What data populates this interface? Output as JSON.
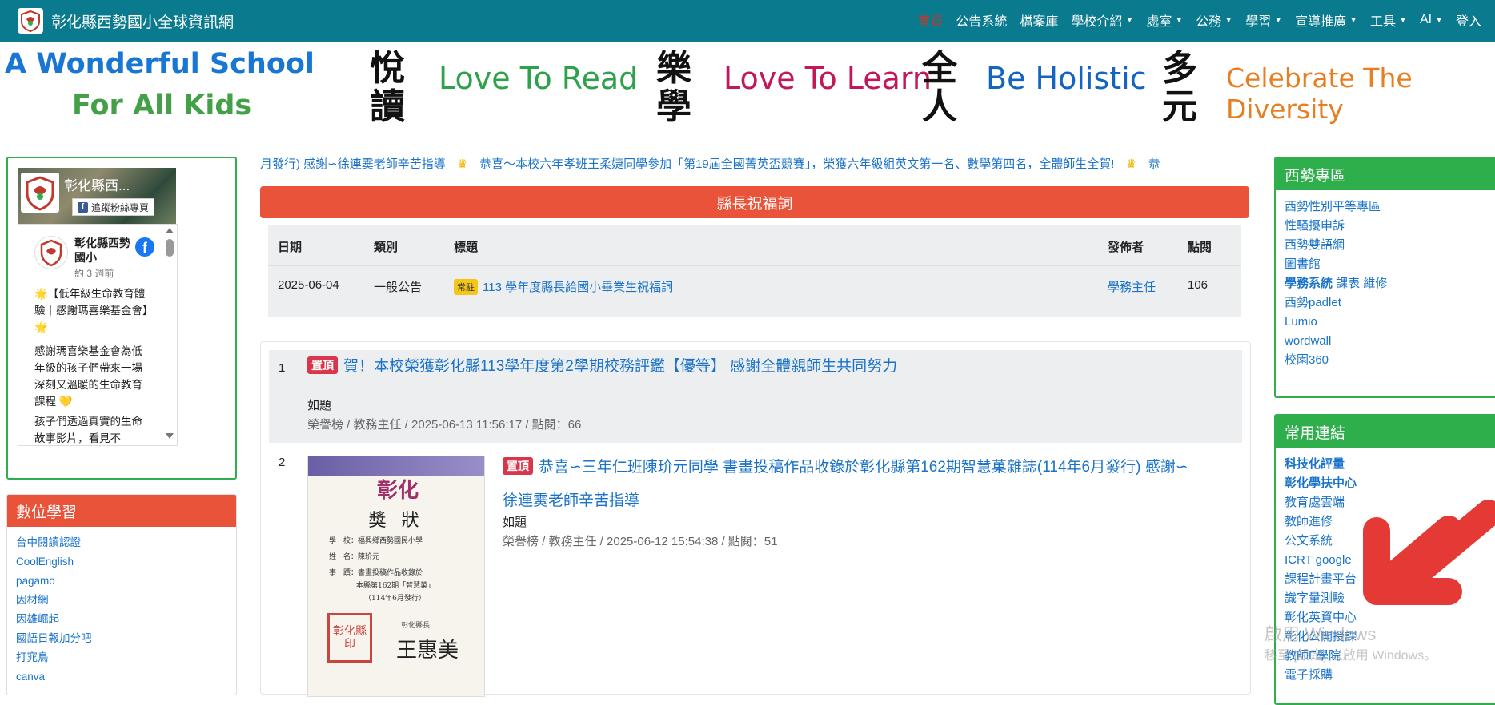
{
  "header": {
    "title": "彰化縣西勢國小全球資訊網",
    "nav": [
      {
        "label": "首頁",
        "active": true,
        "dropdown": false
      },
      {
        "label": "公告系統",
        "dropdown": false
      },
      {
        "label": "檔案庫",
        "dropdown": false
      },
      {
        "label": "學校介紹",
        "dropdown": true
      },
      {
        "label": "處室",
        "dropdown": true
      },
      {
        "label": "公務",
        "dropdown": true
      },
      {
        "label": "學習",
        "dropdown": true
      },
      {
        "label": "宣導推廣",
        "dropdown": true
      },
      {
        "label": "工具",
        "dropdown": true
      },
      {
        "label": "AI",
        "dropdown": true
      },
      {
        "label": "登入",
        "dropdown": false
      }
    ]
  },
  "banner": {
    "line1": "A Wonderful School",
    "line2": "For All Kids",
    "items": [
      {
        "cjk1": "悅",
        "cjk2": "讀",
        "text": "Love To Read",
        "color": "#2da24a"
      },
      {
        "cjk1": "樂",
        "cjk2": "學",
        "text": "Love To Learn",
        "color": "#c2185b"
      },
      {
        "cjk1": "全",
        "cjk2": "人",
        "text": "Be Holistic",
        "color": "#1565c0"
      },
      {
        "cjk1": "多",
        "cjk2": "元",
        "text": "Celebrate The Diversity",
        "color": "#e67e22"
      }
    ]
  },
  "facebook": {
    "page_name": "彰化縣西...",
    "follow_label": "追蹤粉絲專頁",
    "post_name": "彰化縣西勢國小",
    "post_time": "約 3 週前",
    "post_line1": "🌟【低年級生命教育體驗｜感謝瑪喜樂基金會】🌟",
    "post_line2": "感謝瑪喜樂基金會為低年級的孩子們帶來一場深刻又溫暖的生命教育課程 💛",
    "post_line3": "孩子們透過真實的生命故事影片，看見不"
  },
  "digital": {
    "title": "數位學習",
    "links": [
      "台中閱讀認證",
      "CoolEnglish",
      "pagamo",
      "因材網",
      "因雄崛起",
      "國語日報加分吧",
      "打窕鳥",
      "canva"
    ]
  },
  "marquee": {
    "lead": "月發行) 感謝∽徐連霙老師辛苦指導",
    "item": "恭喜～本校六年孝班王柔婕同學參加「第19屆全國菁英盃競賽」，榮獲六年級組英文第一名、數學第四名，全體師生全賀!",
    "tail": "恭"
  },
  "announcement": {
    "title": "縣長祝福詞",
    "headers": {
      "date": "日期",
      "type": "類別",
      "subject": "標題",
      "publisher": "發佈者",
      "clicks": "點閱"
    },
    "row": {
      "date": "2025-06-04",
      "type": "一般公告",
      "badge": "常駐",
      "subject": "113 學年度縣長給國小畢業生祝福詞",
      "publisher": "學務主任",
      "clicks": "106"
    }
  },
  "news": [
    {
      "num": "1",
      "badge": "置頂",
      "title": "賀！本校榮獲彰化縣113學年度第2學期校務評鑑【優等】 感謝全體親師生共同努力",
      "sub": "如題",
      "meta": "榮譽榜 / 教務主任 / 2025-06-13 11:56:17 / 點閱：66"
    },
    {
      "num": "2",
      "badge": "置頂",
      "title1": "恭喜∽三年仁班陳玠元同學 書畫投稿作品收錄於彰化縣第162期智慧菓雜誌(114年6月發行) 感謝∽",
      "title2": "徐連霙老師辛苦指導",
      "sub": "如題",
      "meta": "榮譽榜 / 教務主任 / 2025-06-12 15:54:38 / 點閱：51"
    }
  ],
  "certificate": {
    "logo": "彰化",
    "title": "獎 狀",
    "line1": "學　校：福興鄉西勢國民小學",
    "line2": "姓　名：陳玠元",
    "line3": "事　蹟：書畫投稿作品收錄於",
    "line4": "本縣第162期「智慧菓」",
    "line5": "（114年6月發行）",
    "seal": "彰化縣印",
    "signer": "彰化縣長",
    "signature": "王惠美"
  },
  "xishi": {
    "title": "西勢專區",
    "links": [
      "西勢性別平等專區",
      "性騷擾申訴",
      "西勢雙語網",
      "圖書館"
    ],
    "system_bold": "學務系統",
    "system_rest": " 課表 維修",
    "links2": [
      "西勢padlet",
      "Lumio",
      "wordwall",
      "校園360"
    ]
  },
  "common": {
    "title": "常用連結",
    "bold_links": [
      "科技化評量",
      "彰化學扶中心"
    ],
    "links": [
      "教育處雲端",
      "教師進修",
      "公文系統",
      "ICRT google",
      "課程計畫平台",
      "識字量測驗",
      "彰化英資中心",
      "彰化公開授課",
      "教師E學院",
      "電子採購"
    ]
  },
  "watermark": {
    "line1": "啟用 Windows",
    "line2": "移至 [設定] 以啟用 Windows。"
  },
  "colors": {
    "topbar": "#0a7a8f",
    "orange": "#e8533a",
    "green": "#2fae4c",
    "link": "#1a73c9",
    "badge_red": "#d9364c",
    "badge_yellow": "#f5c518",
    "arrow": "#e53935"
  }
}
